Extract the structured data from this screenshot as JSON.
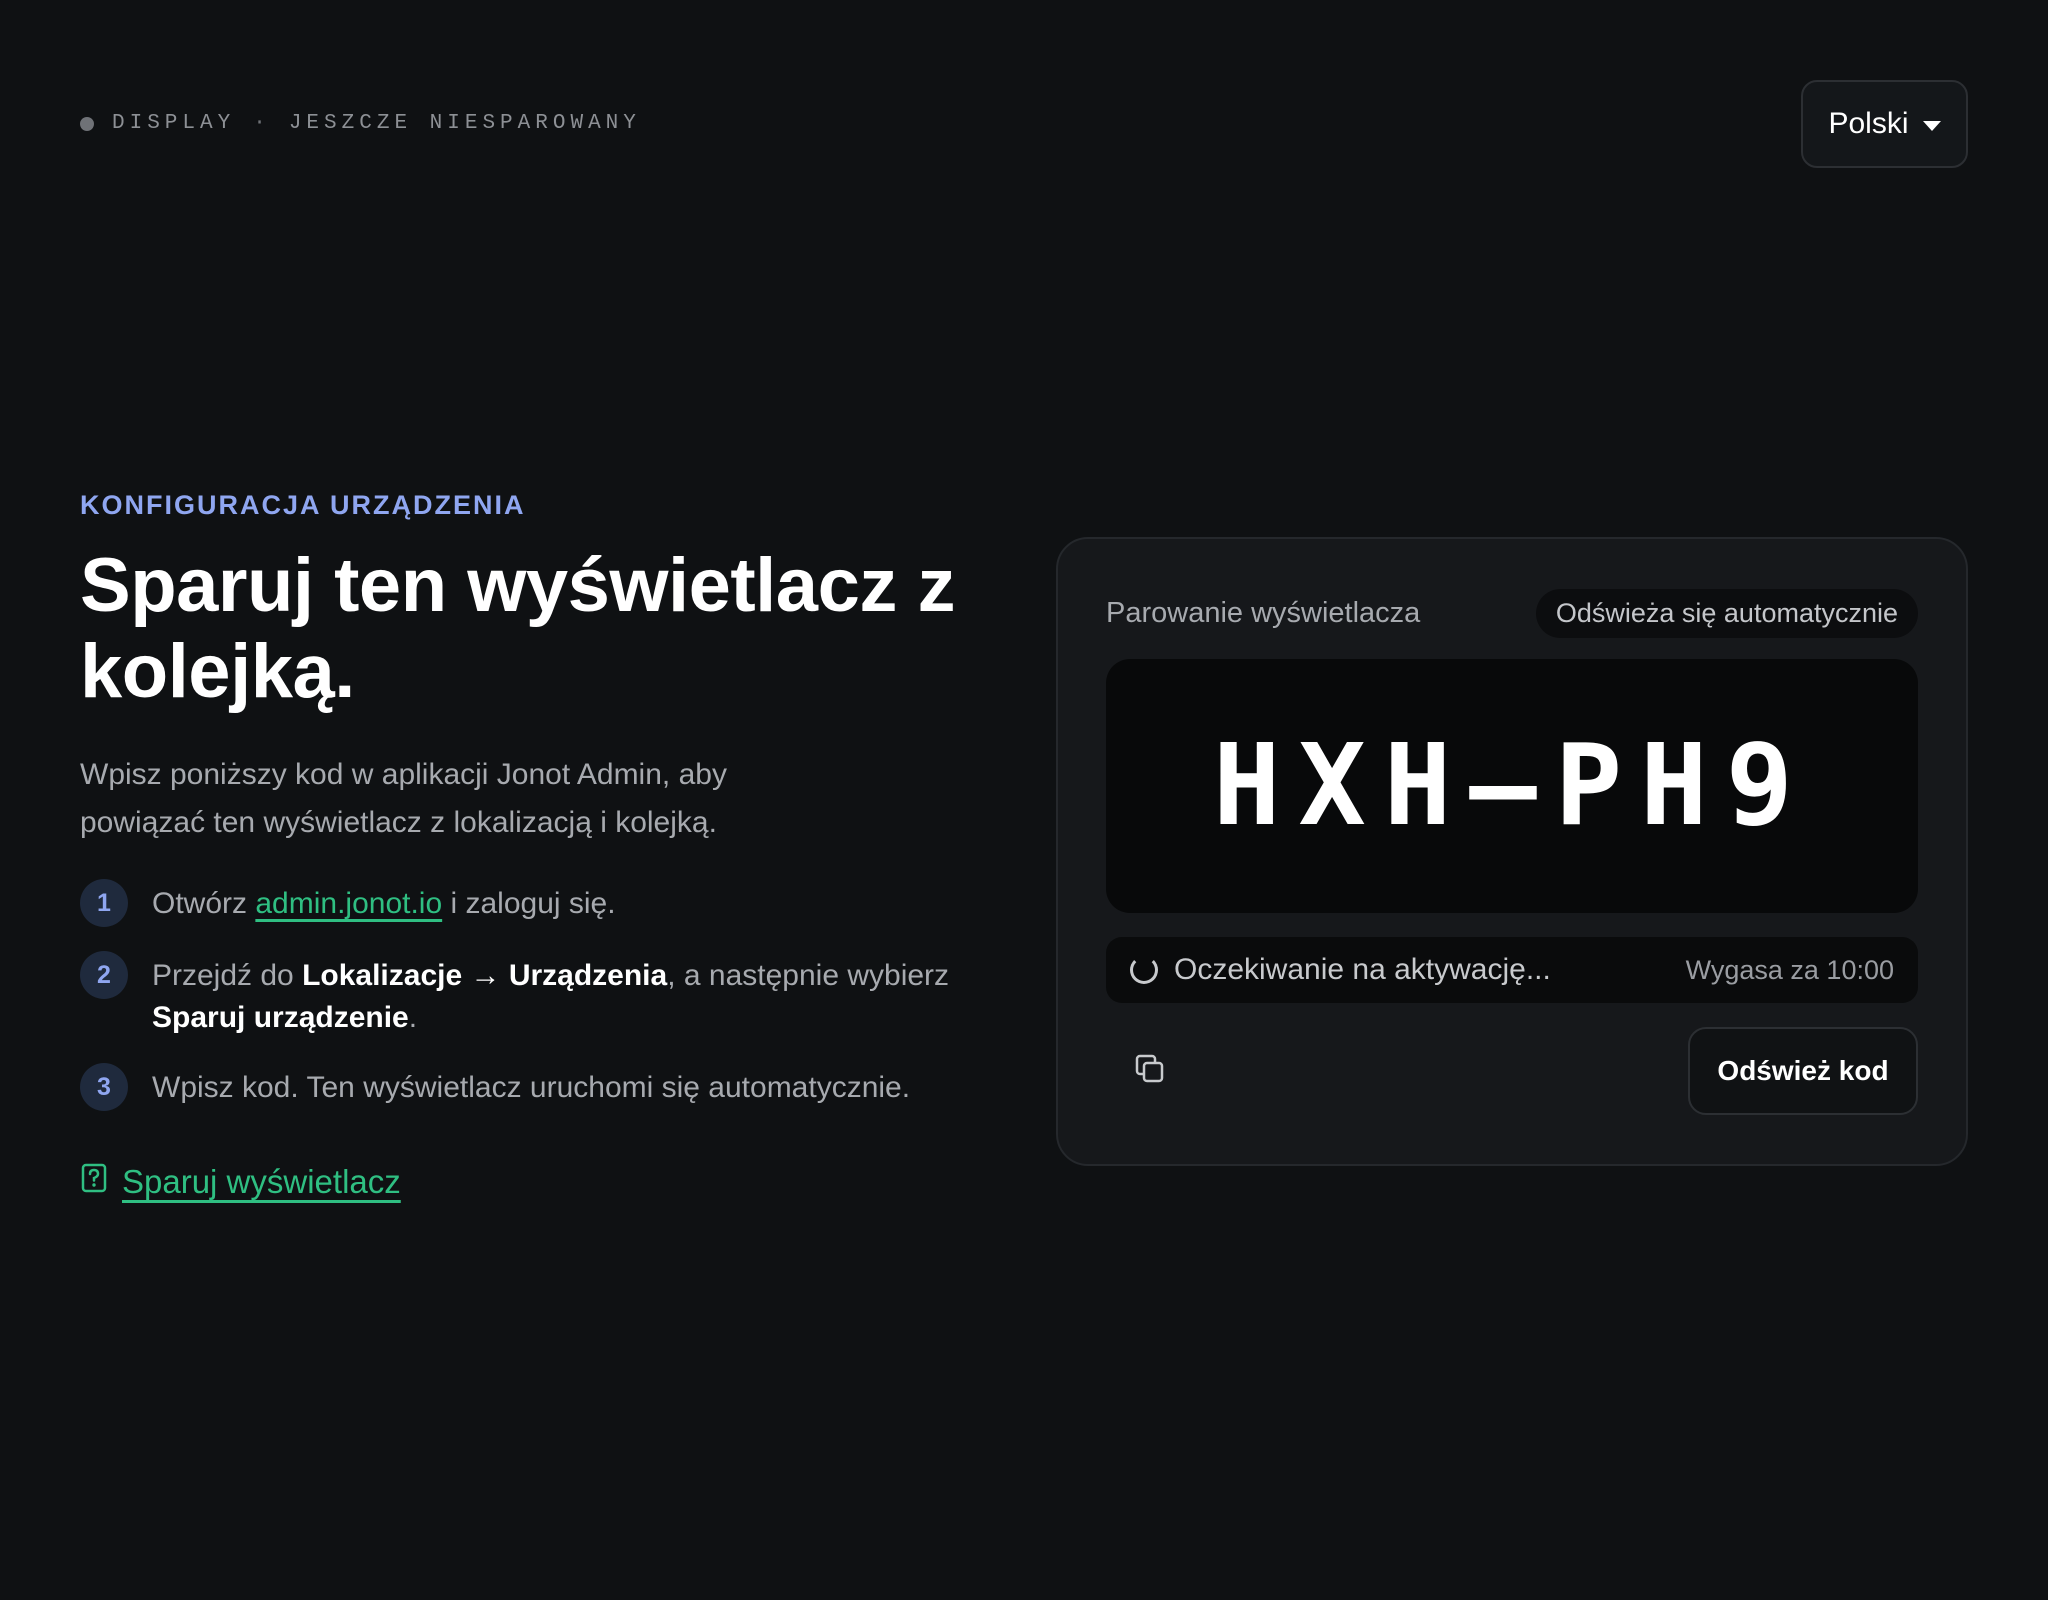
{
  "status": {
    "device": "DISPLAY",
    "separator": "·",
    "state": "JESZCZE NIESPAROWANY"
  },
  "language": {
    "selected": "Polski"
  },
  "intro": {
    "eyebrow": "KONFIGURACJA URZĄDZENIA",
    "title": "Sparuj ten wyświetlacz z kolejką.",
    "description": "Wpisz poniższy kod w aplikacji Jonot Admin, aby powiązać ten wyświetlacz z lokalizacją i kolejką."
  },
  "steps": [
    {
      "number": "1",
      "prefix": "Otwórz ",
      "link": "admin.jonot.io",
      "suffix": " i zaloguj się."
    },
    {
      "number": "2",
      "prefix": "Przejdź do ",
      "bold1": "Lokalizacje → Urządzenia",
      "middle": ", a następnie wybierz ",
      "bold2": "Sparuj urządzenie",
      "suffix": "."
    },
    {
      "number": "3",
      "text": "Wpisz kod. Ten wyświetlacz uruchomi się automatycznie."
    }
  ],
  "help_link": {
    "label": "Sparuj wyświetlacz",
    "icon": "help-document-icon"
  },
  "card": {
    "title": "Parowanie wyświetlacza",
    "badge": "Odświeża się automatycznie",
    "code": "HXH–PH9",
    "waiting": "Oczekiwanie na aktywację...",
    "expires": "Wygasa za 10:00",
    "refresh_label": "Odśwież kod",
    "copy_icon": "copy-icon"
  },
  "colors": {
    "background": "#0f1113",
    "accent_blue": "#8fa6f0",
    "accent_green": "#2fbf82",
    "card": "#16181b"
  }
}
